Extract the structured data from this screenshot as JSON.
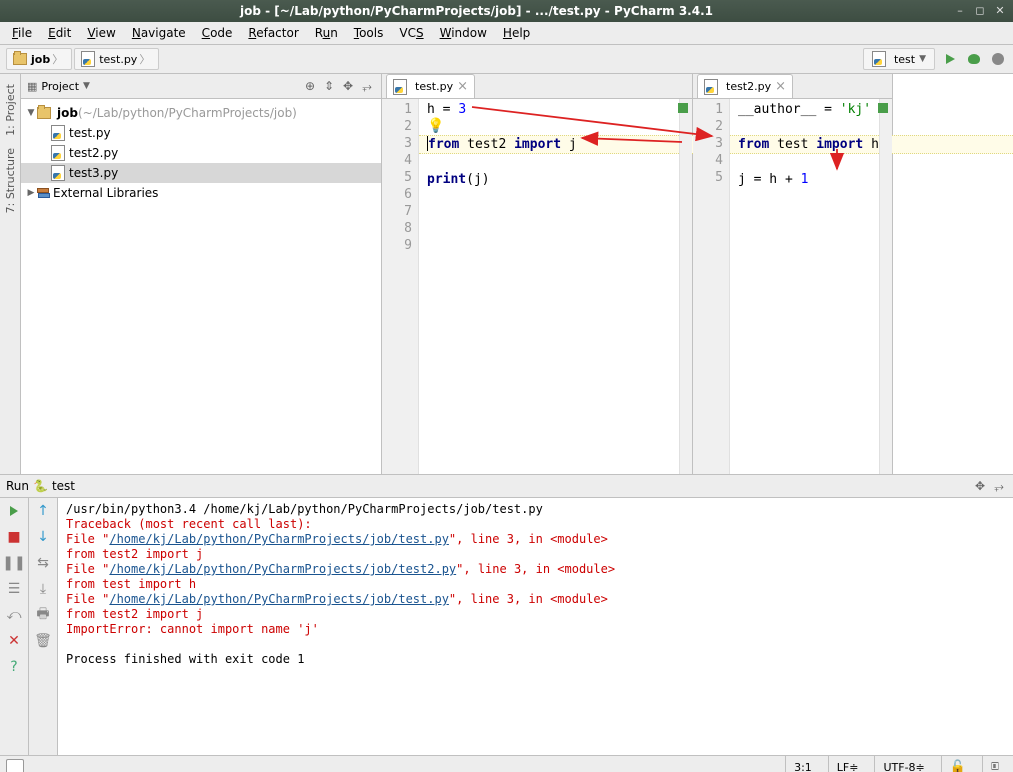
{
  "title": "job - [~/Lab/python/PyCharmProjects/job] - .../test.py - PyCharm 3.4.1",
  "menu": [
    "File",
    "Edit",
    "View",
    "Navigate",
    "Code",
    "Refactor",
    "Run",
    "Tools",
    "VCS",
    "Window",
    "Help"
  ],
  "breadcrumb": {
    "root": "job",
    "file": "test.py"
  },
  "run_config": "test",
  "project": {
    "header": "Project",
    "root": "job",
    "root_path": "(~/Lab/python/PyCharmProjects/job)",
    "files": [
      "test.py",
      "test2.py",
      "test3.py"
    ],
    "ext_lib": "External Libraries"
  },
  "editor1": {
    "tab": "test.py",
    "lines": [
      "h = 3",
      "",
      "from test2 import j",
      "",
      "print(j)",
      "",
      "",
      "",
      ""
    ],
    "hl_line": 2
  },
  "editor2": {
    "tab": "test2.py",
    "lines": [
      "__author__ = 'kj'",
      "",
      "from test import h",
      "",
      "j = h + 1"
    ],
    "hl_line": 2
  },
  "run": {
    "label": "Run",
    "name": "test",
    "cmd": "/usr/bin/python3.4 /home/kj/Lab/python/PyCharmProjects/job/test.py",
    "tb_head": "Traceback (most recent call last):",
    "f1": "  File \"",
    "p1": "/home/kj/Lab/python/PyCharmProjects/job/test.py",
    "f1b": "\", line 3, in <module>",
    "l1": "    from test2 import j",
    "f2": "  File \"",
    "p2": "/home/kj/Lab/python/PyCharmProjects/job/test2.py",
    "f2b": "\", line 3, in <module>",
    "l2": "    from test import h",
    "f3": "  File \"",
    "p3": "/home/kj/Lab/python/PyCharmProjects/job/test.py",
    "f3b": "\", line 3, in <module>",
    "l3": "    from test2 import j",
    "err": "ImportError: cannot import name 'j'",
    "exit": "Process finished with exit code 1"
  },
  "status": {
    "pos": "3:1",
    "le": "LF",
    "enc": "UTF-8"
  }
}
